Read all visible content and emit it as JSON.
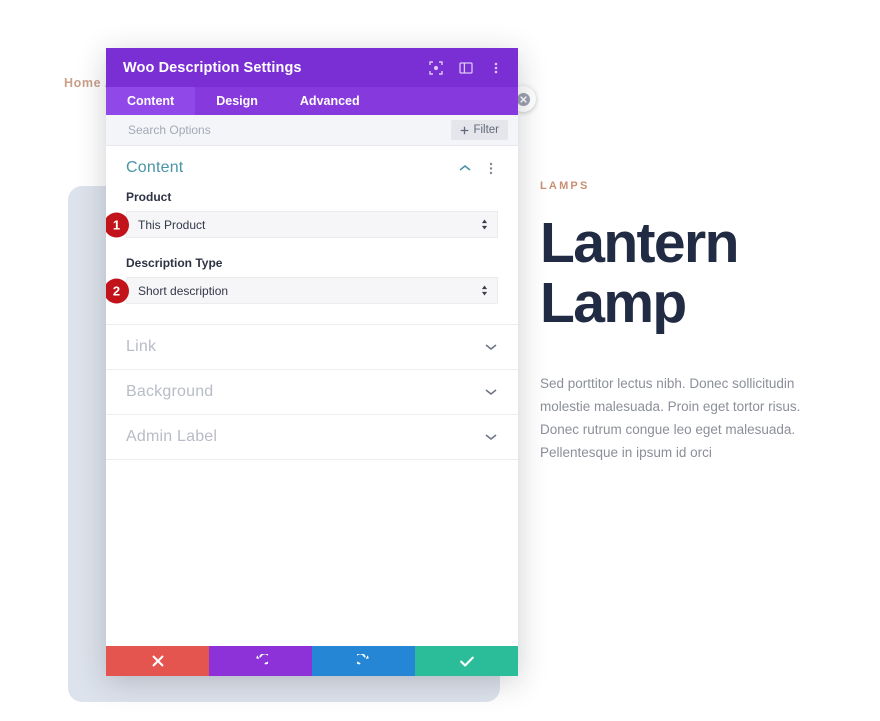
{
  "page": {
    "breadcrumb": "Home /",
    "product": {
      "eyebrow": "LAMPS",
      "title": "Lantern Lamp",
      "description": "Sed porttitor lectus nibh. Donec sollicitudin molestie malesuada. Proin eget tortor risus. Donec rutrum congue leo eget malesuada. Pellentesque in ipsum id orci"
    }
  },
  "modal": {
    "title": "Woo Description Settings",
    "header_icons": [
      {
        "name": "focus-icon"
      },
      {
        "name": "layout-panel-icon"
      },
      {
        "name": "more-vertical-icon"
      }
    ],
    "tabs": [
      {
        "label": "Content",
        "active": true
      },
      {
        "label": "Design",
        "active": false
      },
      {
        "label": "Advanced",
        "active": false
      }
    ],
    "search": {
      "placeholder": "Search Options",
      "value": "",
      "filter_label": "Filter"
    },
    "sections": [
      {
        "title": "Content",
        "state": "open",
        "fields": [
          {
            "label": "Product",
            "value": "This Product",
            "badge": "1"
          },
          {
            "label": "Description Type",
            "value": "Short description",
            "badge": "2"
          }
        ]
      },
      {
        "title": "Link",
        "state": "closed"
      },
      {
        "title": "Background",
        "state": "closed"
      },
      {
        "title": "Admin Label",
        "state": "closed"
      }
    ],
    "footer": [
      {
        "name": "cancel-button",
        "icon": "x-icon"
      },
      {
        "name": "undo-button",
        "icon": "undo-icon"
      },
      {
        "name": "redo-button",
        "icon": "redo-icon"
      },
      {
        "name": "save-button",
        "icon": "check-icon"
      }
    ]
  },
  "colors": {
    "header_purple": "#792fd4",
    "tabbar_purple": "#8639dd",
    "tab_active_purple": "#9148e8",
    "badge_red": "#c2121a",
    "cancel_red": "#e5554f",
    "undo_purple": "#8c32d8",
    "redo_blue": "#2586d6",
    "save_green": "#2bbd9a",
    "section_open_teal": "#4b94a8",
    "eyebrow_tan": "#c98f74",
    "title_navy": "#212b43"
  }
}
